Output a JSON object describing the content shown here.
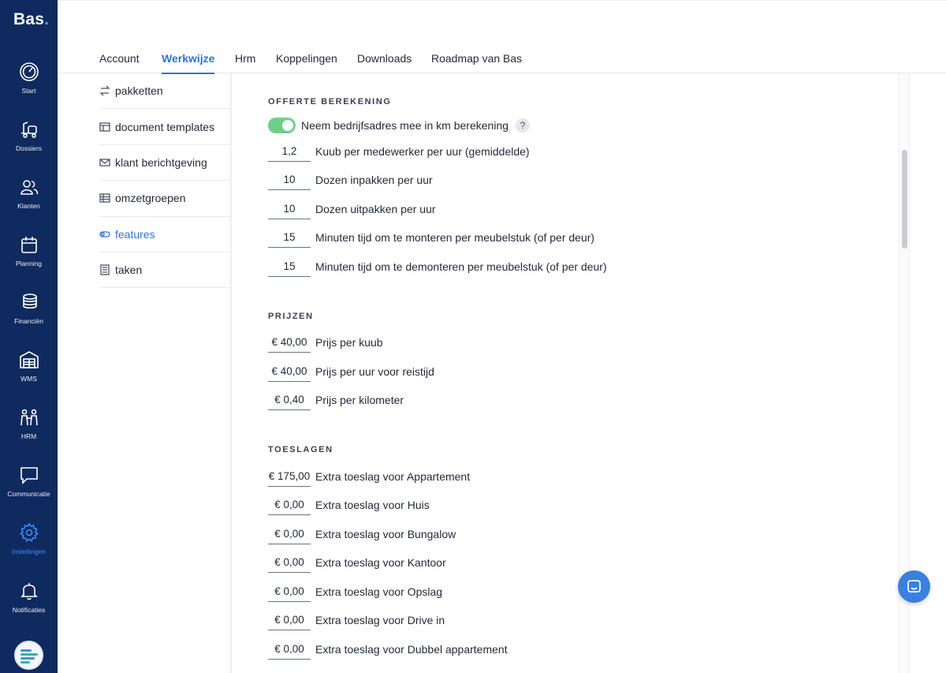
{
  "brand": {
    "name": "Bas",
    "dot": "."
  },
  "nav": {
    "items": [
      {
        "label": "Start",
        "icon": "gauge-icon"
      },
      {
        "label": "Dossiers",
        "icon": "truck-icon"
      },
      {
        "label": "Klanten",
        "icon": "users-icon"
      },
      {
        "label": "Planning",
        "icon": "calendar-icon"
      },
      {
        "label": "Financiën",
        "icon": "coins-icon"
      },
      {
        "label": "WMS",
        "icon": "warehouse-icon"
      },
      {
        "label": "HRM",
        "icon": "team-icon"
      },
      {
        "label": "Communicatie",
        "icon": "chat-bubble-icon"
      },
      {
        "label": "Instellingen",
        "icon": "gear-icon"
      },
      {
        "label": "Notificaties",
        "icon": "bell-icon"
      }
    ],
    "active": "Instellingen"
  },
  "tabs": [
    "Account",
    "Werkwijze",
    "Hrm",
    "Koppelingen",
    "Downloads",
    "Roadmap van Bas"
  ],
  "active_tab": "Werkwijze",
  "submenu": {
    "items": [
      {
        "label": "pakketten",
        "icon": "swap-icon"
      },
      {
        "label": "document templates",
        "icon": "layout-icon"
      },
      {
        "label": "klant berichtgeving",
        "icon": "mail-icon"
      },
      {
        "label": "omzetgroepen",
        "icon": "table-icon"
      },
      {
        "label": "features",
        "icon": "toggle-icon"
      },
      {
        "label": "taken",
        "icon": "list-icon"
      }
    ],
    "active": "features"
  },
  "sections": {
    "offerte": {
      "title": "OFFERTE BEREKENING",
      "toggle": {
        "label": "Neem bedrijfsadres mee in km berekening",
        "on": true,
        "help": "?"
      },
      "rows": [
        {
          "value": "1,2",
          "label": "Kuub per medewerker per uur (gemiddelde)"
        },
        {
          "value": "10",
          "label": "Dozen inpakken per uur"
        },
        {
          "value": "10",
          "label": "Dozen uitpakken per uur"
        },
        {
          "value": "15",
          "label": "Minuten tijd om te monteren per meubelstuk (of per deur)"
        },
        {
          "value": "15",
          "label": "Minuten tijd om te demonteren per meubelstuk (of per deur)"
        }
      ]
    },
    "prijzen": {
      "title": "PRIJZEN",
      "rows": [
        {
          "value": "€ 40,00",
          "label": "Prijs per kuub"
        },
        {
          "value": "€ 40,00",
          "label": "Prijs per uur voor reistijd"
        },
        {
          "value": "€ 0,40",
          "label": "Prijs per kilometer"
        }
      ]
    },
    "toeslagen": {
      "title": "TOESLAGEN",
      "rows": [
        {
          "value": "€ 175,00",
          "label": "Extra toeslag voor Appartement"
        },
        {
          "value": "€ 0,00",
          "label": "Extra toeslag voor Huis"
        },
        {
          "value": "€ 0,00",
          "label": "Extra toeslag voor Bungalow"
        },
        {
          "value": "€ 0,00",
          "label": "Extra toeslag voor Kantoor"
        },
        {
          "value": "€ 0,00",
          "label": "Extra toeslag voor Opslag"
        },
        {
          "value": "€ 0,00",
          "label": "Extra toeslag voor Drive in"
        },
        {
          "value": "€ 0,00",
          "label": "Extra toeslag voor Dubbel appartement"
        }
      ]
    }
  },
  "colors": {
    "nav_bg": "#0f2a5e",
    "accent": "#2f72d6",
    "toggle_on": "#6fcf8a"
  }
}
